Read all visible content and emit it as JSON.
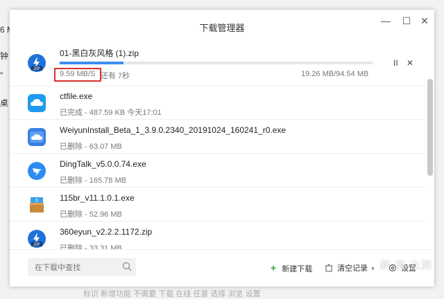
{
  "background": {
    "left_fragments": [
      "6 M",
      "钟",
      "\"",
      "桌"
    ],
    "bottom_text": "标识 新增功能 不需要 下载 在线 任意 选择 浏览 设置"
  },
  "window": {
    "title": "下载管理器",
    "controls": {
      "minimize": "—",
      "maximize": "☐",
      "close": "✕"
    }
  },
  "active_download": {
    "name": "01-黑白灰风格 (1).zip",
    "speed": "9.59 MB/S",
    "remaining": "还有 7秒",
    "size": "19.26 MB/94.54 MB",
    "progress_fraction": 0.2037,
    "pause": "II",
    "cancel": "✕",
    "icon": "zip-file-icon"
  },
  "items": [
    {
      "name": "ctfile.exe",
      "status": "已完成 - 487.59 KB  今天17:01",
      "icon": "cloud-app-icon"
    },
    {
      "name": "WeiyunInstall_Beta_1_3.9.0.2340_20191024_160241_r0.exe",
      "status": "已删除 - 63.07 MB",
      "icon": "weiyun-icon"
    },
    {
      "name": "DingTalk_v5.0.0.74.exe",
      "status": "已删除 - 165.78 MB",
      "icon": "dingtalk-icon"
    },
    {
      "name": "115br_v11.1.0.1.exe",
      "status": "已删除 - 52.96 MB",
      "icon": "115-package-icon"
    },
    {
      "name": "360eyun_v2.2.2.1172.zip",
      "status": "已删除 - 33.31 MB",
      "icon": "zip-file-icon"
    }
  ],
  "footer": {
    "search_placeholder": "在下载中查找",
    "new_download": "新建下载",
    "clear_records": "清空记录",
    "settings": "设置",
    "watermark": "新 浪 众测"
  },
  "colors": {
    "accent": "#3b8ef0",
    "highlight": "#d9302c"
  }
}
